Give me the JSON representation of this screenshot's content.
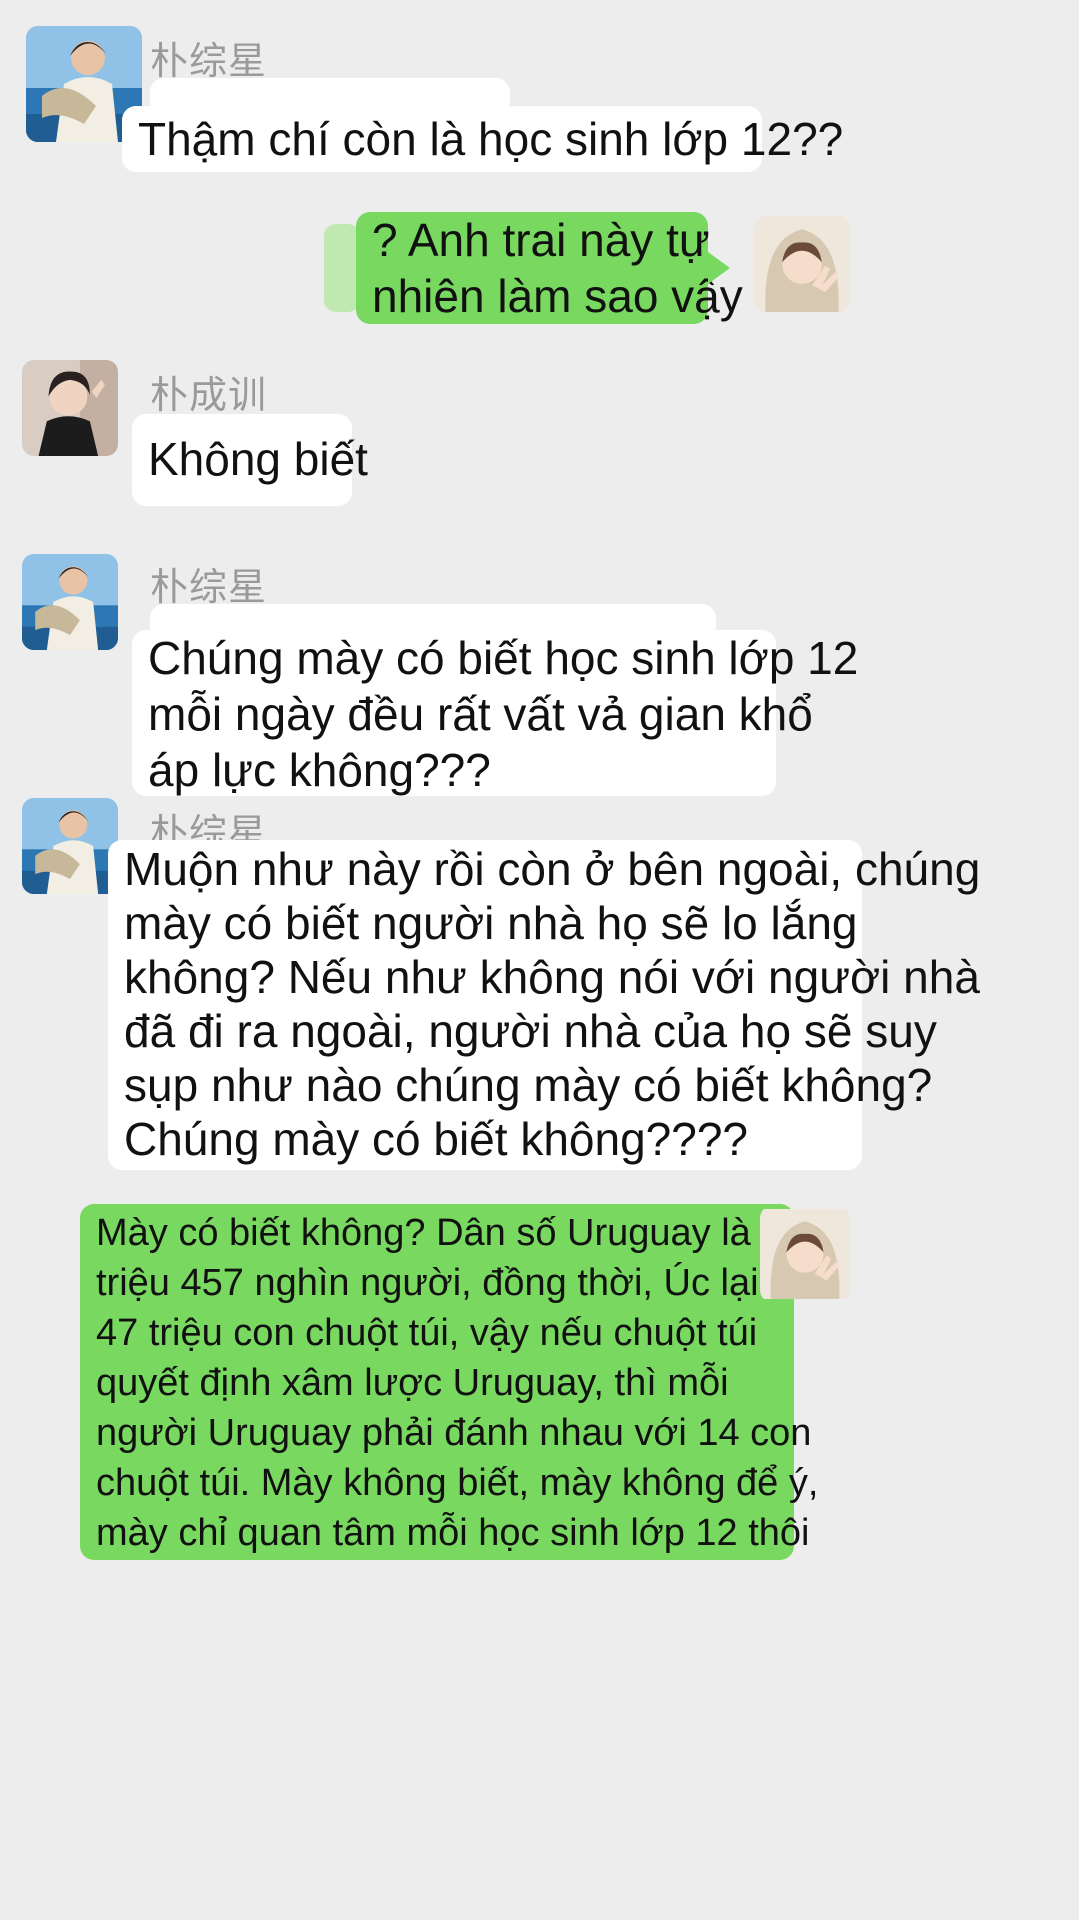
{
  "colors": {
    "background": "#ededed",
    "incoming_bubble": "#ffffff",
    "outgoing_bubble": "#79d85f",
    "sender_name": "#9a9a9a"
  },
  "messages": [
    {
      "direction": "incoming",
      "sender": "朴综星",
      "avatar": "boy-by-sea-avatar",
      "lines": [
        "Thậm chí còn là học sinh lớp 12??"
      ]
    },
    {
      "direction": "outgoing",
      "avatar": "hooded-peace-sign-avatar",
      "lines": [
        "? Anh trai này tự",
        "nhiên làm sao vậy"
      ]
    },
    {
      "direction": "incoming",
      "sender": "朴成训",
      "avatar": "boy-selfie-avatar",
      "lines": [
        "Không biết"
      ]
    },
    {
      "direction": "incoming",
      "sender": "朴综星",
      "avatar": "boy-by-sea-avatar",
      "lines": [
        "Chúng mày có biết học sinh lớp 12",
        "mỗi ngày đều rất vất vả gian khổ",
        "áp lực không???"
      ]
    },
    {
      "direction": "incoming",
      "sender": "朴综星",
      "avatar": "boy-by-sea-avatar",
      "lines": [
        "Muộn như này rồi còn ở bên ngoài, chúng",
        "mày có biết người nhà họ sẽ lo lắng",
        "không? Nếu như không nói với người nhà",
        "đã đi ra ngoài, người nhà của họ sẽ suy",
        "sụp như nào chúng mày có biết không?",
        "Chúng mày có biết không????"
      ]
    },
    {
      "direction": "outgoing",
      "avatar": "hooded-peace-sign-avatar",
      "lines": [
        "Mày có biết không? Dân số Uruguay là 3",
        "triệu 457 nghìn người, đồng thời, Úc lại có",
        "47 triệu con chuột túi, vậy nếu chuột túi",
        "quyết định xâm lược Uruguay, thì mỗi",
        "người Uruguay phải đánh nhau với 14 con",
        "chuột túi. Mày không biết, mày không để ý,",
        "mày chỉ quan tâm mỗi học sinh lớp 12 thôi"
      ]
    }
  ]
}
